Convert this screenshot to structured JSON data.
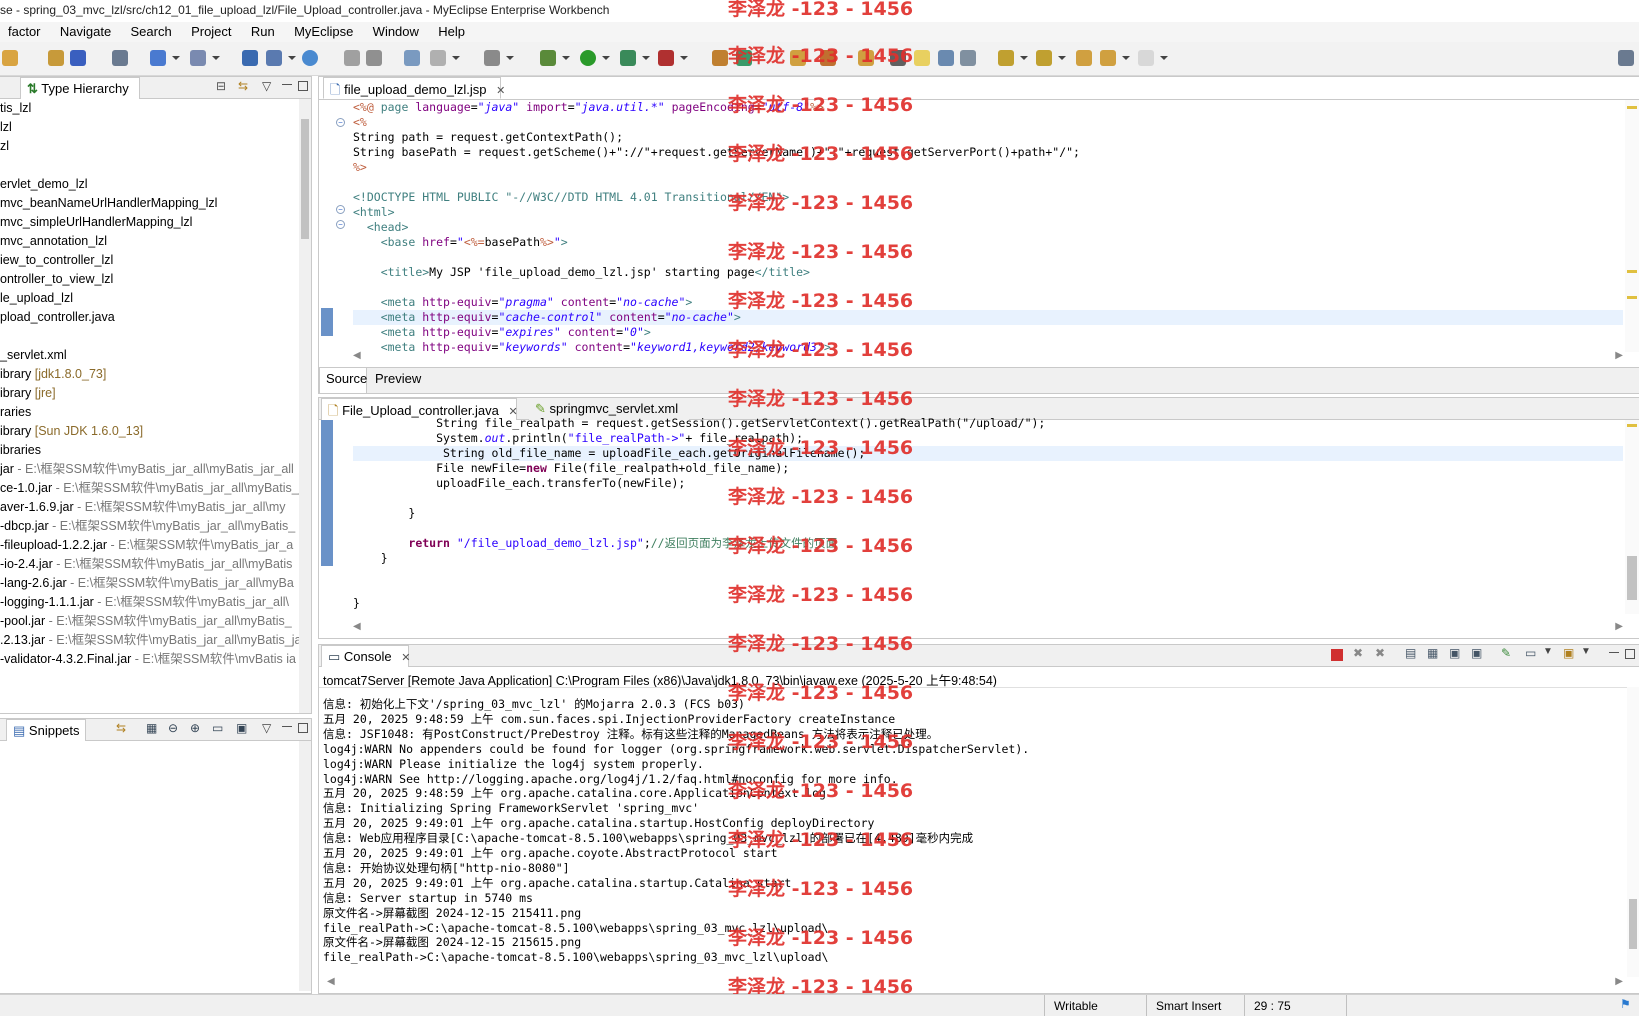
{
  "window": {
    "title": "se - spring_03_mvc_lzl/src/ch12_01_file_upload_lzl/File_Upload_controller.java - MyEclipse Enterprise Workbench"
  },
  "menu": [
    "factor",
    "Navigate",
    "Search",
    "Project",
    "Run",
    "MyEclipse",
    "Window",
    "Help"
  ],
  "left_panel": {
    "tab_label": "Type Hierarchy",
    "items": [
      {
        "text": "tis_lzl",
        "suffix": ""
      },
      {
        "text": "lzl",
        "suffix": ""
      },
      {
        "text": "zl",
        "suffix": ""
      },
      {
        "text": "",
        "suffix": ""
      },
      {
        "text": "ervlet_demo_lzl",
        "suffix": ""
      },
      {
        "text": "mvc_beanNameUrlHandlerMapping_lzl",
        "suffix": ""
      },
      {
        "text": "mvc_simpleUrlHandlerMapping_lzl",
        "suffix": ""
      },
      {
        "text": "mvc_annotation_lzl",
        "suffix": ""
      },
      {
        "text": "iew_to_controller_lzl",
        "suffix": ""
      },
      {
        "text": "ontroller_to_view_lzl",
        "suffix": ""
      },
      {
        "text": "le_upload_lzl",
        "suffix": ""
      },
      {
        "text": "pload_controller.java",
        "suffix": ""
      },
      {
        "text": "",
        "suffix": ""
      },
      {
        "text": "_servlet.xml",
        "suffix": ""
      },
      {
        "text": "ibrary ",
        "suffix": "[jdk1.8.0_73]"
      },
      {
        "text": "ibrary ",
        "suffix": "[jre]"
      },
      {
        "text": "raries",
        "suffix": ""
      },
      {
        "text": "ibrary ",
        "suffix": "[Sun JDK 1.6.0_13]"
      },
      {
        "text": "ibraries",
        "suffix": ""
      },
      {
        "text": "jar",
        "suffix": " - E:\\框架SSM软件\\myBatis_jar_all\\myBatis_jar_all"
      },
      {
        "text": "ce-1.0.jar",
        "suffix": " - E:\\框架SSM软件\\myBatis_jar_all\\myBatis_j"
      },
      {
        "text": "aver-1.6.9.jar",
        "suffix": " - E:\\框架SSM软件\\myBatis_jar_all\\my"
      },
      {
        "text": "-dbcp.jar",
        "suffix": " - E:\\框架SSM软件\\myBatis_jar_all\\myBatis_"
      },
      {
        "text": "-fileupload-1.2.2.jar",
        "suffix": " - E:\\框架SSM软件\\myBatis_jar_a"
      },
      {
        "text": "-io-2.4.jar",
        "suffix": " - E:\\框架SSM软件\\myBatis_jar_all\\myBatis"
      },
      {
        "text": "-lang-2.6.jar",
        "suffix": " - E:\\框架SSM软件\\myBatis_jar_all\\myBa"
      },
      {
        "text": "-logging-1.1.1.jar",
        "suffix": " - E:\\框架SSM软件\\myBatis_jar_all\\"
      },
      {
        "text": "-pool.jar",
        "suffix": " - E:\\框架SSM软件\\myBatis_jar_all\\myBatis_"
      },
      {
        "text": ".2.13.jar",
        "suffix": " - E:\\框架SSM软件\\myBatis_jar_all\\myBatis_ja"
      },
      {
        "text": "-validator-4.3.2.Final.jar",
        "suffix": " - E:\\框架SSM软件\\mvBatis ia"
      }
    ]
  },
  "snippets_panel": {
    "tab_label": "Snippets"
  },
  "jsp_editor": {
    "tab_label": "file_upload_demo_lzl.jsp",
    "bottom_tabs": [
      "Source",
      "Preview"
    ],
    "lines": [
      [
        [
          "jsp",
          "<%@ "
        ],
        [
          "tag",
          "page "
        ],
        [
          "attr",
          "language"
        ],
        [
          "",
          "="
        ],
        [
          "aval",
          "\"java\""
        ],
        [
          "",
          " "
        ],
        [
          "attr",
          "import"
        ],
        [
          "",
          "="
        ],
        [
          "aval",
          "\"java.util.*\""
        ],
        [
          "",
          " "
        ],
        [
          "attr",
          "pageEncoding"
        ],
        [
          "",
          "="
        ],
        [
          "aval",
          "\"utf-8\""
        ],
        [
          "jsp",
          "%>"
        ]
      ],
      [
        [
          "jsp",
          "<%"
        ]
      ],
      [
        [
          "",
          "String path = request.getContextPath();"
        ]
      ],
      [
        [
          "",
          "String basePath = request.getScheme()+\"://\"+request.getServerName()+\":\"+request.getServerPort()+path+\"/\";"
        ]
      ],
      [
        [
          "jsp",
          "%>"
        ]
      ],
      [
        [
          "",
          ""
        ]
      ],
      [
        [
          "tag",
          "<!DOCTYPE HTML PUBLIC \"-//W3C//DTD HTML 4.01 Transitional//EN\">"
        ]
      ],
      [
        [
          "tag",
          "<html>"
        ]
      ],
      [
        [
          "",
          "  "
        ],
        [
          "tag",
          "<head>"
        ]
      ],
      [
        [
          "",
          "    "
        ],
        [
          "tag",
          "<base "
        ],
        [
          "attr",
          "href"
        ],
        [
          "",
          "="
        ],
        [
          "aval",
          "\""
        ],
        [
          "jsp",
          "<%="
        ],
        [
          "",
          "basePath"
        ],
        [
          "jsp",
          "%>"
        ],
        [
          "aval",
          "\""
        ],
        [
          "tag",
          ">"
        ]
      ],
      [
        [
          "",
          ""
        ]
      ],
      [
        [
          "",
          "    "
        ],
        [
          "tag",
          "<title>"
        ],
        [
          "",
          "My JSP 'file_upload_demo_lzl.jsp' starting page"
        ],
        [
          "tag",
          "</title>"
        ]
      ],
      [
        [
          "",
          ""
        ]
      ],
      [
        [
          "",
          "    "
        ],
        [
          "tag",
          "<meta "
        ],
        [
          "attr",
          "http-equiv"
        ],
        [
          "",
          "="
        ],
        [
          "aval",
          "\"pragma\""
        ],
        [
          "",
          " "
        ],
        [
          "attr",
          "content"
        ],
        [
          "",
          "="
        ],
        [
          "aval",
          "\"no-cache\""
        ],
        [
          "tag",
          ">"
        ]
      ],
      [
        [
          "",
          "    "
        ],
        [
          "tag",
          "<meta "
        ],
        [
          "attr",
          "http-equiv"
        ],
        [
          "",
          "="
        ],
        [
          "aval",
          "\"cache-control\""
        ],
        [
          "",
          " "
        ],
        [
          "attr",
          "content"
        ],
        [
          "",
          "="
        ],
        [
          "aval",
          "\"no-cache\""
        ],
        [
          "tag",
          ">"
        ]
      ],
      [
        [
          "",
          "    "
        ],
        [
          "tag",
          "<meta "
        ],
        [
          "attr",
          "http-equiv"
        ],
        [
          "",
          "="
        ],
        [
          "aval",
          "\"expires\""
        ],
        [
          "",
          " "
        ],
        [
          "attr",
          "content"
        ],
        [
          "",
          "="
        ],
        [
          "aval",
          "\"0\""
        ],
        [
          "tag",
          ">"
        ]
      ],
      [
        [
          "",
          "    "
        ],
        [
          "tag",
          "<meta "
        ],
        [
          "attr",
          "http-equiv"
        ],
        [
          "",
          "="
        ],
        [
          "aval",
          "\"keywords\""
        ],
        [
          "",
          " "
        ],
        [
          "attr",
          "content"
        ],
        [
          "",
          "="
        ],
        [
          "aval",
          "\"keyword1,keyword2,keyword3\""
        ],
        [
          "tag",
          ">"
        ]
      ]
    ]
  },
  "java_editor": {
    "tabs": [
      "File_Upload_controller.java",
      "springmvc_servlet.xml"
    ],
    "lines": [
      [
        [
          "",
          "            String file_realpath = request.getSession().getServletContext().getRealPath(\"/upload/\");"
        ]
      ],
      [
        [
          "",
          "            System."
        ],
        [
          "str2",
          "out"
        ],
        [
          "",
          ".println("
        ],
        [
          "str",
          "\"file_realPath->\""
        ],
        [
          "",
          "+ file_realpath);"
        ]
      ],
      [
        [
          "",
          "             String old_file_name = uploadFile_each.getOriginalFilename();"
        ]
      ],
      [
        [
          "",
          "            File newFile="
        ],
        [
          "kw",
          "new"
        ],
        [
          "",
          " File(file_realpath+old_file_name);"
        ]
      ],
      [
        [
          "",
          "            uploadFile_each.transferTo(newFile);"
        ]
      ],
      [
        [
          "",
          ""
        ]
      ],
      [
        [
          "",
          "        }"
        ]
      ],
      [
        [
          "",
          ""
        ]
      ],
      [
        [
          "",
          "        "
        ],
        [
          "kw",
          "return"
        ],
        [
          "",
          " "
        ],
        [
          "str",
          "\"/file_upload_demo_lzl.jsp\""
        ],
        [
          "",
          ";"
        ],
        [
          "cm",
          "//返回页面为李泽龙上传文件的页面"
        ]
      ],
      [
        [
          "",
          "    }"
        ]
      ],
      [
        [
          "",
          ""
        ]
      ],
      [
        [
          "",
          ""
        ]
      ],
      [
        [
          "",
          "}"
        ]
      ]
    ]
  },
  "console": {
    "tab_label": "Console",
    "header": "tomcat7Server [Remote Java Application] C:\\Program Files (x86)\\Java\\jdk1.8.0_73\\bin\\javaw.exe (2025-5-20 上午9:48:54)",
    "lines": [
      "信息: 初始化上下文'/spring_03_mvc_lzl' 的Mojarra 2.0.3 (FCS b03)",
      "五月 20, 2025 9:48:59 上午 com.sun.faces.spi.InjectionProviderFactory createInstance",
      "信息: JSF1048: 有PostConstruct/PreDestroy 注释。标有这些注释的ManagedBeans 方法将表示注释已处理。",
      "log4j:WARN No appenders could be found for logger (org.springframework.web.servlet.DispatcherServlet).",
      "log4j:WARN Please initialize the log4j system properly.",
      "log4j:WARN See http://logging.apache.org/log4j/1.2/faq.html#noconfig for more info.",
      "五月 20, 2025 9:48:59 上午 org.apache.catalina.core.ApplicationContext log",
      "信息: Initializing Spring FrameworkServlet 'spring_mvc'",
      "五月 20, 2025 9:49:01 上午 org.apache.catalina.startup.HostConfig deployDirectory",
      "信息: Web应用程序目录[C:\\apache-tomcat-8.5.100\\webapps\\spring_03_mvc_lzl]的部署已在[4,489]毫秒内完成",
      "五月 20, 2025 9:49:01 上午 org.apache.coyote.AbstractProtocol start",
      "信息: 开始协议处理句柄[\"http-nio-8080\"]",
      "五月 20, 2025 9:49:01 上午 org.apache.catalina.startup.Catalina start",
      "信息: Server startup in 5740 ms",
      "原文件名->屏幕截图 2024-12-15 215411.png",
      "file_realPath->C:\\apache-tomcat-8.5.100\\webapps\\spring_03_mvc_lzl\\upload\\",
      "原文件名->屏幕截图 2024-12-15 215615.png",
      "file_realPath->C:\\apache-tomcat-8.5.100\\webapps\\spring_03_mvc_lzl\\upload\\"
    ]
  },
  "watermark": "李泽龙 -123 - 1456",
  "status": {
    "writable": "Writable",
    "insert": "Smart Insert",
    "position": "29 : 75"
  }
}
